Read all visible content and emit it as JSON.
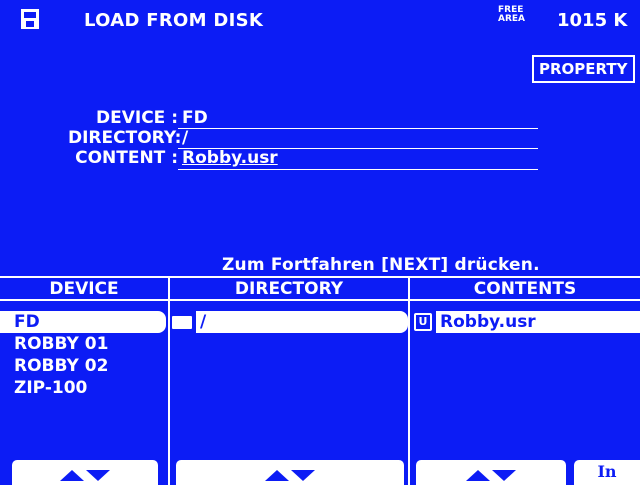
{
  "header": {
    "title": "LOAD FROM DISK",
    "free_area_line1": "FREE",
    "free_area_line2": "AREA",
    "free_size": "1015 K",
    "property_label": "PROPERTY"
  },
  "info": {
    "device_label": "DEVICE :",
    "device_value": "FD",
    "directory_label": "DIRECTORY:",
    "directory_value": "/",
    "content_label": "CONTENT :",
    "content_value": "Robby.usr"
  },
  "message": "Zum Fortfahren [NEXT] drücken.",
  "columns": {
    "device": "DEVICE",
    "directory": "DIRECTORY",
    "contents": "CONTENTS"
  },
  "device_list": [
    {
      "label": "FD",
      "selected": true
    },
    {
      "label": "ROBBY 01",
      "selected": false
    },
    {
      "label": "ROBBY 02",
      "selected": false
    },
    {
      "label": "ZIP-100",
      "selected": false
    }
  ],
  "directory_list": [
    {
      "label": "/",
      "icon": "folder-icon",
      "selected": true
    }
  ],
  "contents_list": [
    {
      "label": "Robby.usr",
      "icon_text": "U",
      "selected": true
    }
  ],
  "buttons": {
    "in_label": "In"
  },
  "colors": {
    "background": "#0c1cf5",
    "foreground": "#ffffff"
  }
}
